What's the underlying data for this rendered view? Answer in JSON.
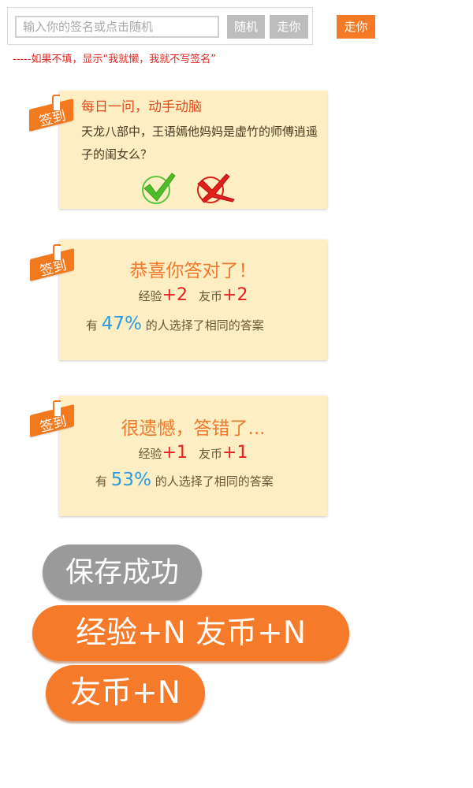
{
  "signature": {
    "placeholder": "输入你的签名或点击随机",
    "random_label": "随机",
    "go_label_gray": "走你",
    "go_label_orange": "走你",
    "hint": "-----如果不填，显示“我就懒，我就不写签名”"
  },
  "tag_label": "签到",
  "question_card": {
    "title": "每日一问，动手动脑",
    "question": "天龙八部中，王语嫣他妈妈是虚竹的师傅逍遥子的闺女么？",
    "right_icon": "check-icon",
    "wrong_icon": "cross-icon"
  },
  "correct_card": {
    "title": "恭喜你答对了！",
    "exp_label": "经验",
    "exp_value": "+2",
    "coin_label": "友币",
    "coin_value": "+2",
    "stat_prefix": "有",
    "stat_pct": "47%",
    "stat_suffix": "的人选择了相同的答案"
  },
  "wrong_card": {
    "title": "很遗憾，答错了...",
    "exp_label": "经验",
    "exp_value": "+1",
    "coin_label": "友币",
    "coin_value": "+1",
    "stat_prefix": "有",
    "stat_pct": "53%",
    "stat_suffix": "的人选择了相同的答案"
  },
  "toasts": {
    "saved": "保存成功",
    "exp_coin": "经验+N 友币+N",
    "coin": "友币+N"
  },
  "colors": {
    "accent": "#f47a26",
    "card_bg": "#fdefc3",
    "gray_button": "#bdbdbd",
    "hint_red": "#e1261c",
    "percent_blue": "#2a9ce6"
  }
}
